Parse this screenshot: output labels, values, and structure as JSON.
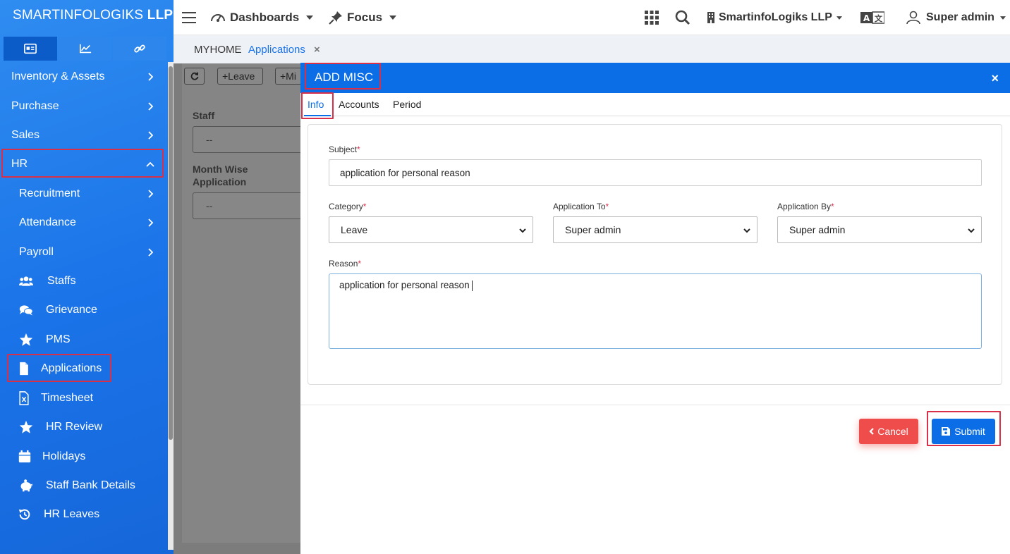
{
  "brand": {
    "name_light": "SMARTINFOLOGIKS",
    "name_bold": "LLP"
  },
  "sidebar": {
    "tabs": [
      {
        "icon": "id-card-icon"
      },
      {
        "icon": "chart-line-icon"
      },
      {
        "icon": "link-icon"
      }
    ],
    "items": [
      {
        "label": "Inventory & Assets",
        "type": "group"
      },
      {
        "label": "Purchase",
        "type": "group"
      },
      {
        "label": "Sales",
        "type": "group"
      },
      {
        "label": "HR",
        "type": "group-open"
      },
      {
        "label": "Recruitment",
        "type": "sub-group"
      },
      {
        "label": "Attendance",
        "type": "sub-group"
      },
      {
        "label": "Payroll",
        "type": "sub-group"
      },
      {
        "label": "Staffs",
        "icon": "users-icon"
      },
      {
        "label": "Grievance",
        "icon": "comments-icon"
      },
      {
        "label": "PMS",
        "icon": "star-icon"
      },
      {
        "label": "Applications",
        "icon": "file-icon",
        "active": true
      },
      {
        "label": "Timesheet",
        "icon": "excel-file-icon"
      },
      {
        "label": "HR Review",
        "icon": "star-icon"
      },
      {
        "label": "Holidays",
        "icon": "calendar-icon"
      },
      {
        "label": "Staff Bank Details",
        "icon": "piggy-bank-icon"
      },
      {
        "label": "HR Leaves",
        "icon": "history-icon"
      }
    ]
  },
  "topbar": {
    "dashboards": "Dashboards",
    "focus": "Focus",
    "company": "SmartinfoLogiks LLP",
    "user": "Super admin"
  },
  "breadcrumb": {
    "home": "MYHOME",
    "current": "Applications",
    "close": "×"
  },
  "content": {
    "buttons": [
      "+Leave",
      "+Mi"
    ],
    "staff_label": "Staff",
    "staff_value": "--",
    "monthwise_label_1": "Month Wise",
    "monthwise_label_2": "Application",
    "monthwise_value": "--"
  },
  "modal": {
    "title": "ADD MISC",
    "close": "×",
    "tabs": [
      "Info",
      "Accounts",
      "Period"
    ],
    "active_tab": "Info",
    "fields": {
      "subject": {
        "label": "Subject",
        "value": "application for personal reason"
      },
      "category": {
        "label": "Category",
        "value": "Leave"
      },
      "application_to": {
        "label": "Application To",
        "value": "Super admin"
      },
      "application_by": {
        "label": "Application By",
        "value": "Super admin"
      },
      "reason": {
        "label": "Reason",
        "value": "application for personal reason"
      }
    },
    "required_marker": "*",
    "cancel": "Cancel",
    "submit": "Submit"
  },
  "colors": {
    "primary": "#0b6ee6",
    "danger": "#ef4c4c",
    "highlight": "#d9304a",
    "sidebar": "#1a73e8"
  }
}
